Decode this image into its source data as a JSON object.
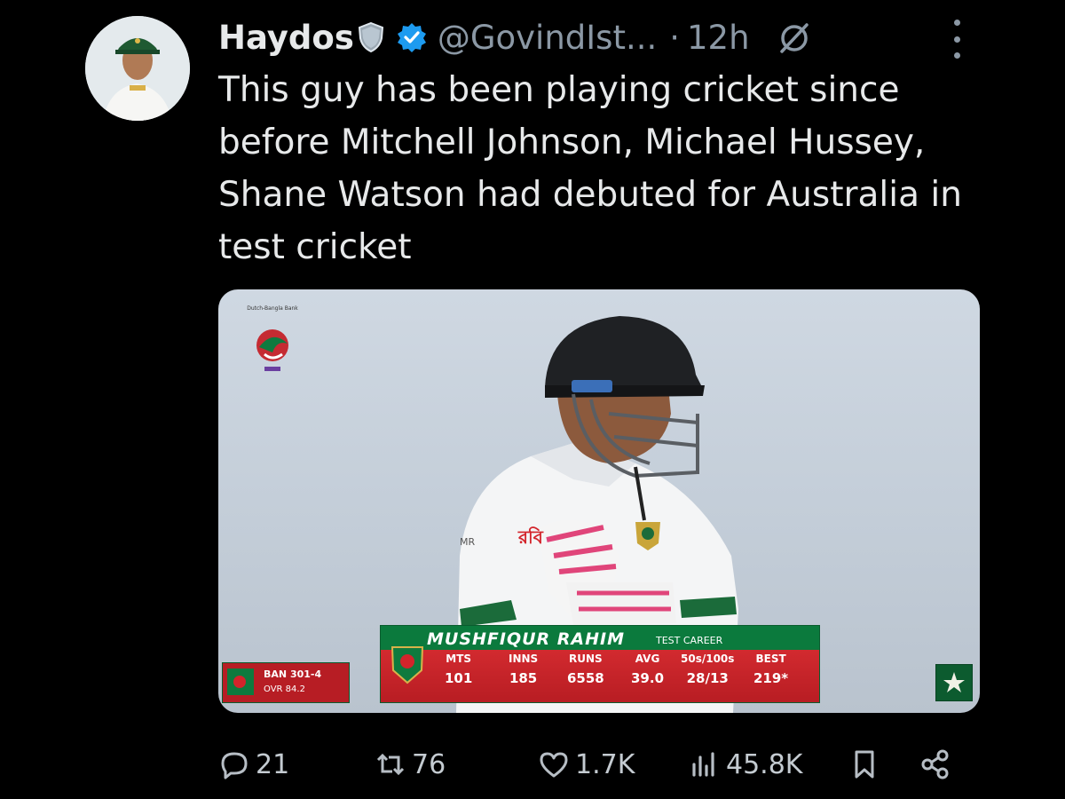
{
  "author": {
    "name": "Haydos",
    "handle": "@GovindIst...",
    "time_sep": "·",
    "time": "12h"
  },
  "tweet": {
    "text": "This guy has been playing cricket since before Mitchell Johnson, Michael Hussey, Shane Watson had debuted for Australia in test cricket"
  },
  "media": {
    "broadcast_logo_text": "Dutch-Bangla Bank",
    "shirt_text": "MR",
    "graphic": {
      "player_name": "MUSHFIQUR RAHIM",
      "subtitle": "TEST CAREER",
      "stats": [
        {
          "label": "MTS",
          "value": "101"
        },
        {
          "label": "INNS",
          "value": "185"
        },
        {
          "label": "RUNS",
          "value": "6558"
        },
        {
          "label": "AVG",
          "value": "39.0"
        },
        {
          "label": "50s/100s",
          "value": "28/13"
        },
        {
          "label": "BEST",
          "value": "219*"
        }
      ]
    },
    "scoreboard": {
      "team": "BAN",
      "score": "301-4",
      "overs_label": "OVR",
      "overs": "84.2"
    }
  },
  "actions": {
    "replies": "21",
    "reposts": "76",
    "likes": "1.7K",
    "views": "45.8K"
  },
  "colors": {
    "background": "#000000",
    "text": "#e7e9ea",
    "muted": "#8b98a5",
    "verified": "#1d9bf0",
    "banner_green": "#0b7a3d",
    "banner_red": "#c4232a"
  }
}
